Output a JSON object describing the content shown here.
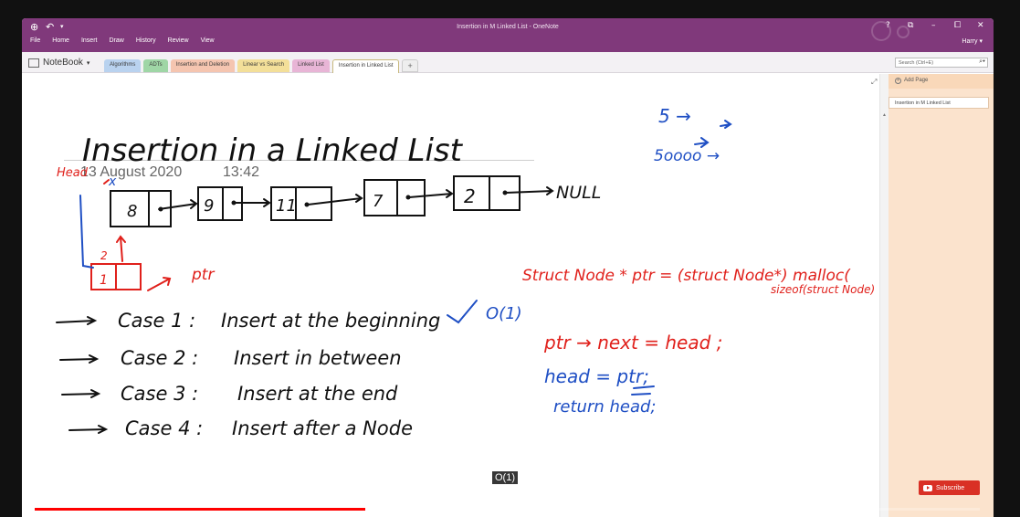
{
  "window": {
    "title": "Insertion in M Linked List - OneNote",
    "menu": [
      "File",
      "Home",
      "Insert",
      "Draw",
      "History",
      "Review",
      "View"
    ],
    "user": "Harry",
    "controls": {
      "help": "?",
      "minimize": "–",
      "restore": "⧉",
      "close": "✕"
    }
  },
  "notebook": {
    "label": "NoteBook"
  },
  "sections": [
    {
      "label": "Algorithms",
      "color": "#b9d2ef"
    },
    {
      "label": "ADTs",
      "color": "#9fd6a6"
    },
    {
      "label": "Insertion and Deletion",
      "color": "#f5c5b0"
    },
    {
      "label": "Linear vs Search",
      "color": "#f3df99"
    },
    {
      "label": "Linked List",
      "color": "#e8b5d6"
    },
    {
      "label": "Insertion in Linked List",
      "color": "#f7d79a",
      "active": true
    }
  ],
  "add_section": "+",
  "search": {
    "placeholder": "Search (Ctrl+E)"
  },
  "page": {
    "date": "13 August 2020",
    "time": "13:42",
    "ink": {
      "title": "Insertion in a Linked List",
      "head_label": "Head",
      "x_mark": "x",
      "nodes": [
        "8",
        "9",
        "11",
        "7",
        "2"
      ],
      "null_label": "NULL",
      "new_node": "1",
      "two_mark": "2",
      "ptr_label": "ptr",
      "cases": [
        {
          "name": "Case 1 :",
          "desc": "Insert at the beginning"
        },
        {
          "name": "Case 2 :",
          "desc": "Insert in between"
        },
        {
          "name": "Case 3 :",
          "desc": "Insert at the end"
        },
        {
          "name": "Case 4 :",
          "desc": "Insert after a Node"
        }
      ],
      "complexity": "O(1)",
      "note_5": "5 →",
      "note_5000": "5oooo →",
      "malloc_line1": "Struct Node * ptr = (struct Node*) malloc(",
      "malloc_line2": "sizeof(struct Node)",
      "code_line1": "ptr → next = head ;",
      "code_line2": "head = ptr;",
      "code_line3": "return head;"
    }
  },
  "pages_pane": {
    "add_page": "Add Page",
    "items": [
      "Insertion in M Linked List"
    ]
  },
  "video": {
    "caption": "O(1)",
    "subscribe": "Subscribe",
    "progress_played": 0.35,
    "progress_buffered": 0.465
  },
  "colors": {
    "titlebar": "#80397b",
    "ink_black": "#111111",
    "ink_red": "#e0201b",
    "ink_blue": "#1f4fc4"
  }
}
